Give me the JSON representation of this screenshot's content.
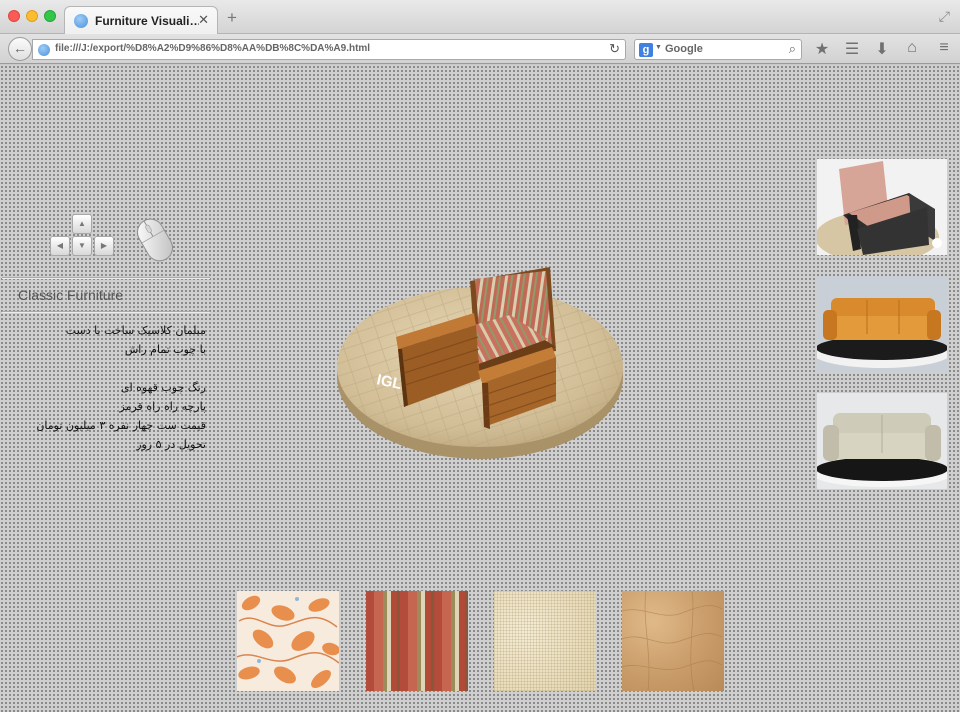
{
  "window": {
    "tab_title": "Furniture Visuali…",
    "tab_close": "✕",
    "new_tab": "+",
    "restore": "⤢"
  },
  "toolbar": {
    "back": "←",
    "url": "file:///J:/export/%D8%A2%D9%86%D8%AA%DB%8C%DA%A9.html",
    "reload": "↻",
    "search_engine": "g",
    "search_placeholder": "Google",
    "search_icon": "⌕",
    "bookmark_icon": "★",
    "reading_list_icon": "☰",
    "downloads_icon": "⬇",
    "home_icon": "⌂",
    "menu_icon": "≡"
  },
  "sidebar": {
    "title": "Classic Furniture",
    "description": "مبلمان کلاسیک ساخت با دست\nبا چوب تمام راش\n\nرنگ چوب قهوه ای\nپارچه راه راه قرمز\nقیمت ست چهار نفره ۳ میلیون تومان\nتحویل در ۵ روز"
  },
  "viewer": {
    "brand": "IGLOO"
  },
  "thumbnails": [
    {
      "name": "dark-wood-armchair"
    },
    {
      "name": "orange-leather-sofa"
    },
    {
      "name": "beige-sofa"
    }
  ],
  "swatches": [
    {
      "name": "floral-orange"
    },
    {
      "name": "red-stripe"
    },
    {
      "name": "linen"
    },
    {
      "name": "leather-tan"
    }
  ]
}
